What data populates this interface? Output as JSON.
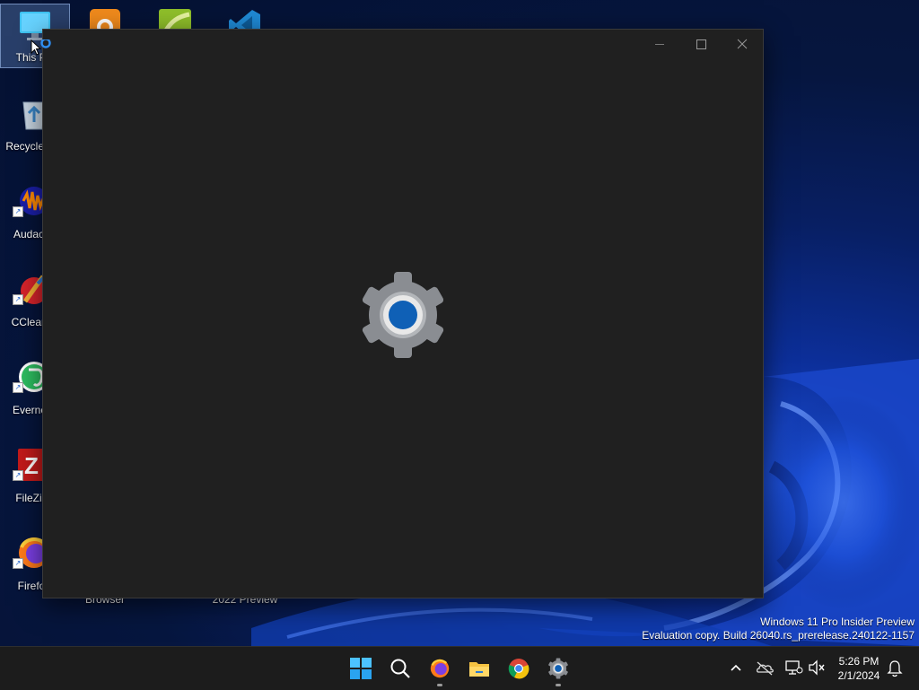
{
  "desktop": {
    "icons": [
      {
        "label": "This PC",
        "icon": "monitor-icon"
      },
      {
        "label": "Recycle Bin",
        "icon": "recycle-bin-icon"
      },
      {
        "label": "Audacity",
        "icon": "audacity-icon"
      },
      {
        "label": "CCleaner",
        "icon": "ccleaner-icon"
      },
      {
        "label": "Evernote",
        "icon": "evernote-icon"
      },
      {
        "label": "FileZilla",
        "icon": "filezilla-icon"
      },
      {
        "label": "Firefox",
        "icon": "firefox-icon"
      }
    ],
    "top_row_icons": [
      {
        "icon": "orange-app-icon",
        "label": "Browser"
      },
      {
        "icon": "green-app-icon",
        "label": ""
      },
      {
        "icon": "vscode-icon",
        "label": "2022 Preview"
      }
    ],
    "watermark": {
      "line1": "Windows 11 Pro Insider Preview",
      "line2": "Evaluation copy. Build 26040.rs_prerelease.240122-1157"
    }
  },
  "window": {
    "app": "Settings",
    "buttons": {
      "minimize": "–",
      "maximize": "☐",
      "close": "✕"
    },
    "splash_icon": "settings-gear-icon"
  },
  "taskbar": {
    "apps": [
      {
        "name": "start",
        "icon": "windows-start-icon",
        "running": false
      },
      {
        "name": "search",
        "icon": "search-icon",
        "running": false
      },
      {
        "name": "firefox",
        "icon": "firefox-icon",
        "running": true
      },
      {
        "name": "file-explorer",
        "icon": "folder-icon",
        "running": false
      },
      {
        "name": "chrome",
        "icon": "chrome-icon",
        "running": false
      },
      {
        "name": "settings",
        "icon": "settings-gear-icon",
        "running": true
      }
    ],
    "tray": [
      "chevron-up-icon",
      "onedrive-icon",
      "network-icon",
      "volume-muted-icon"
    ],
    "clock": {
      "time": "5:26 PM",
      "date": "2/1/2024"
    },
    "notification_icon": "bell-icon"
  },
  "colors": {
    "window_bg": "#202020",
    "taskbar_bg": "#1c1c1c",
    "accent": "#0063b1"
  }
}
